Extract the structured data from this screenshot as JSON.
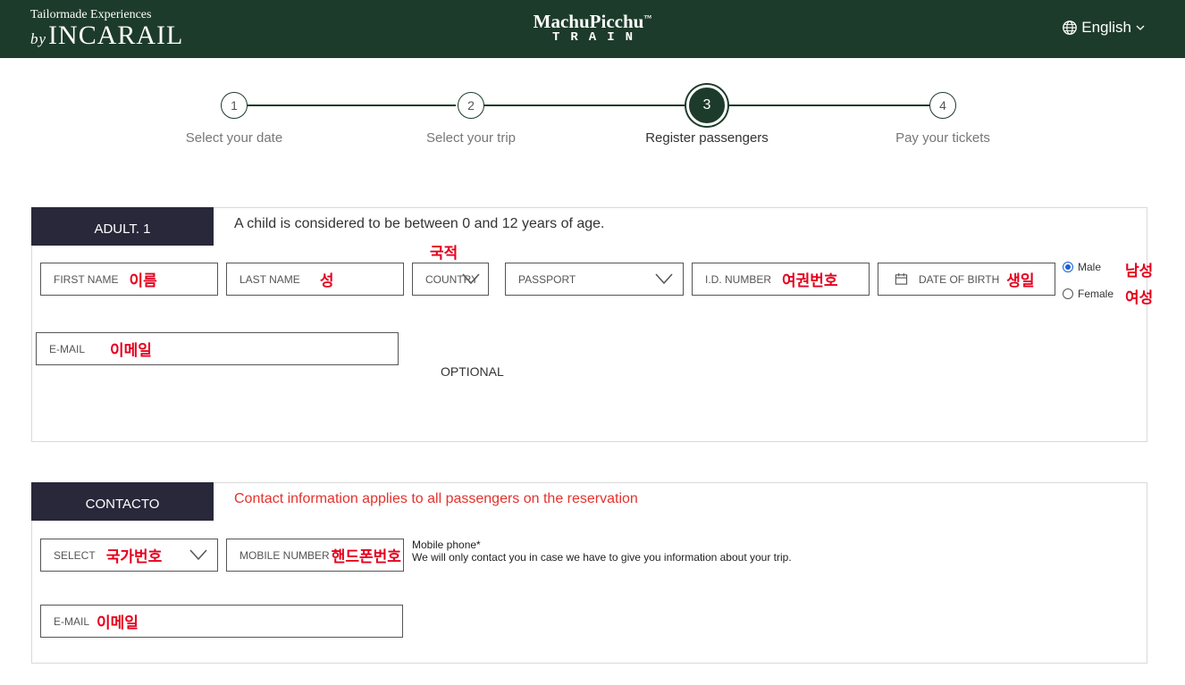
{
  "header": {
    "brand_tagline": "Tailormade Experiences",
    "brand_by": "by",
    "brand_name": "INCARAIL",
    "center_title": "MachuPicchu",
    "center_tm": "™",
    "center_sub": "TRAIN",
    "language": "English",
    "globe_icon": "globe-icon",
    "chevron_icon": "chevron-down-icon",
    "bg_color": "#1d3b2a"
  },
  "stepper": {
    "steps": [
      {
        "number": "1",
        "label": "Select your date",
        "active": false
      },
      {
        "number": "2",
        "label": "Select your trip",
        "active": false
      },
      {
        "number": "3",
        "label": "Register passengers",
        "active": true
      },
      {
        "number": "4",
        "label": "Pay your tickets",
        "active": false
      }
    ]
  },
  "passenger": {
    "tag": "ADULT. 1",
    "note": "A child is considered to be between 0 and 12 years of age.",
    "first_name": {
      "placeholder": "FIRST NAME",
      "annotation": "이름"
    },
    "last_name": {
      "placeholder": "LAST NAME",
      "annotation": "성"
    },
    "country": {
      "placeholder": "COUNTRY",
      "annotation": "국적"
    },
    "document": {
      "value": "PASSPORT"
    },
    "id_number": {
      "placeholder": "I.D. NUMBER",
      "annotation": "여권번호"
    },
    "birth": {
      "placeholder": "DATE OF BIRTH",
      "annotation": "생일",
      "icon": "calendar-icon"
    },
    "gender": {
      "male": {
        "label": "Male",
        "annotation": "남성",
        "checked": true
      },
      "female": {
        "label": "Female",
        "annotation": "여성",
        "checked": false
      }
    },
    "email": {
      "placeholder": "E-MAIL",
      "annotation": "이메일"
    },
    "optional": "OPTIONAL"
  },
  "contact": {
    "tag": "CONTACTO",
    "note": "Contact information applies to all passengers on the reservation",
    "note_color": "#e5322d",
    "country_code": {
      "placeholder": "SELECT",
      "annotation": "국가번호"
    },
    "mobile": {
      "placeholder": "MOBILE NUMBER",
      "annotation": "핸드폰번호"
    },
    "mobile_label": "Mobile phone*",
    "mobile_help": "We will only contact you in case we have to give you information about your trip.",
    "email": {
      "placeholder": "E-MAIL",
      "annotation": "이메일"
    }
  }
}
